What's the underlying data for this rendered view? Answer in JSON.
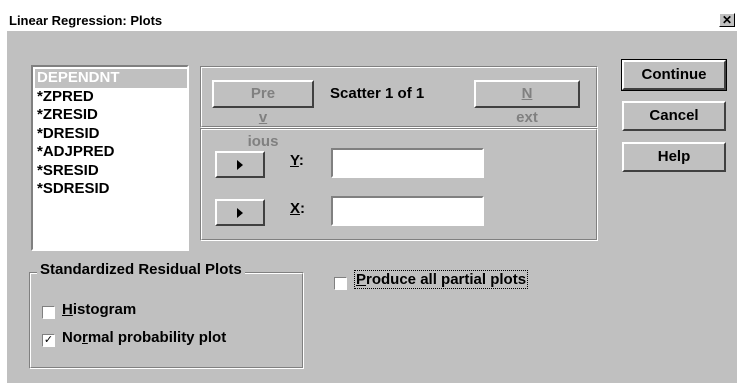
{
  "window": {
    "title": "Linear Regression: Plots",
    "close_glyph": "✕"
  },
  "variables": [
    "DEPENDNT",
    "*ZPRED",
    "*ZRESID",
    "*DRESID",
    "*ADJPRED",
    "*SRESID",
    "*SDRESID"
  ],
  "scatter": {
    "previous_label": "Previous",
    "status": "Scatter 1 of 1",
    "next_label": "Next",
    "y_label": "Y:",
    "x_label": "X:",
    "y_value": "",
    "x_value": ""
  },
  "buttons": {
    "continue": "Continue",
    "cancel": "Cancel",
    "help": "Help"
  },
  "residual_group": {
    "legend": "Standardized Residual Plots",
    "histogram_label": "Histogram",
    "histogram_checked": false,
    "normal_label": "Normal probability plot",
    "normal_checked": true
  },
  "partial_plots": {
    "label": "Produce all partial plots",
    "checked": false
  },
  "icons": {
    "move-right": "triangle-right-icon",
    "check": "check-icon"
  }
}
